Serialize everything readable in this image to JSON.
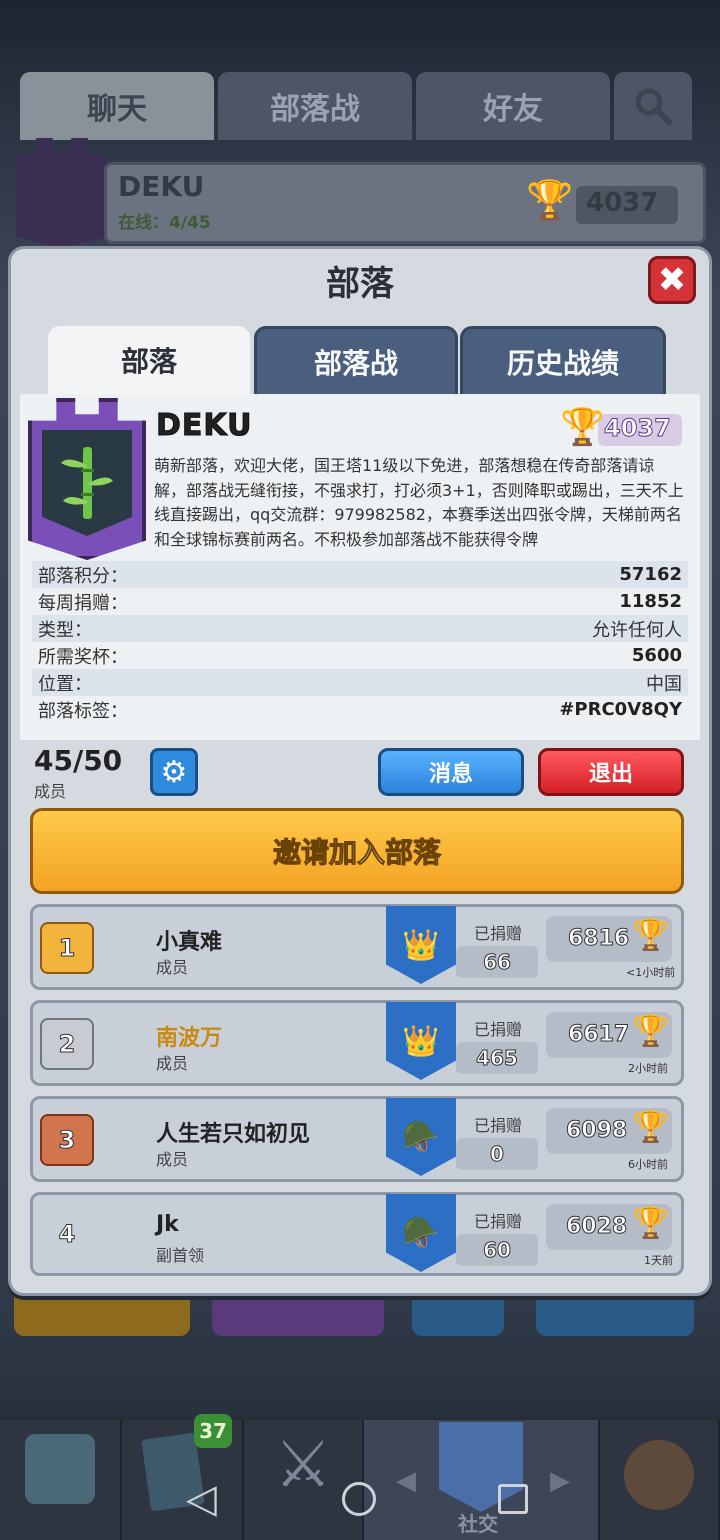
{
  "background": {
    "tabs": [
      "聊天",
      "部落战",
      "好友"
    ],
    "clan_name": "DEKU",
    "online": "在线：4/45",
    "trophies": "4037",
    "nav_badge": "37",
    "nav_label": "社交"
  },
  "modal": {
    "title": "部落",
    "tabs": [
      "部落",
      "部落战",
      "历史战绩"
    ],
    "clan": {
      "name": "DEKU",
      "trophies": "4037",
      "description": "萌新部落，欢迎大佬，国王塔11级以下免进，部落想稳在传奇部落请谅解，部落战无缝衔接，不强求打，打必须3+1，否则降职或踢出，三天不上线直接踢出，qq交流群：979982582，本赛季送出四张令牌，天梯前两名和全球锦标赛前两名。不积极参加部落战不能获得令牌"
    },
    "stats": [
      {
        "label": "部落积分：",
        "value": "57162"
      },
      {
        "label": "每周捐赠：",
        "value": "11852"
      },
      {
        "label": "类型：",
        "value": "允许任何人"
      },
      {
        "label": "所需奖杯：",
        "value": "5600"
      },
      {
        "label": "位置：",
        "value": "中国"
      },
      {
        "label": "部落标签：",
        "value": "#PRC0V8QY"
      }
    ],
    "members_count": "45/50",
    "members_label": "成员",
    "message_button": "消息",
    "leave_button": "退出",
    "invite_button": "邀请加入部落",
    "donated_label": "已捐赠",
    "members": [
      {
        "rank": "1",
        "name": "小真难",
        "role": "成员",
        "donated": "66",
        "trophies": "6816",
        "last_seen": "<1小时前"
      },
      {
        "rank": "2",
        "name": "南波万",
        "role": "成员",
        "donated": "465",
        "trophies": "6617",
        "last_seen": "2小时前"
      },
      {
        "rank": "3",
        "name": "人生若只如初见",
        "role": "成员",
        "donated": "0",
        "trophies": "6098",
        "last_seen": "6小时前"
      },
      {
        "rank": "4",
        "name": "Jk",
        "role": "副首领",
        "donated": "60",
        "trophies": "6028",
        "last_seen": "1天前"
      }
    ]
  },
  "colors": {
    "rank1": "#f2b43c",
    "rank2": "#c8ccd2",
    "rank3": "#d2744e",
    "rank4": "#c8cfd8",
    "name2": "#f2b43c"
  }
}
